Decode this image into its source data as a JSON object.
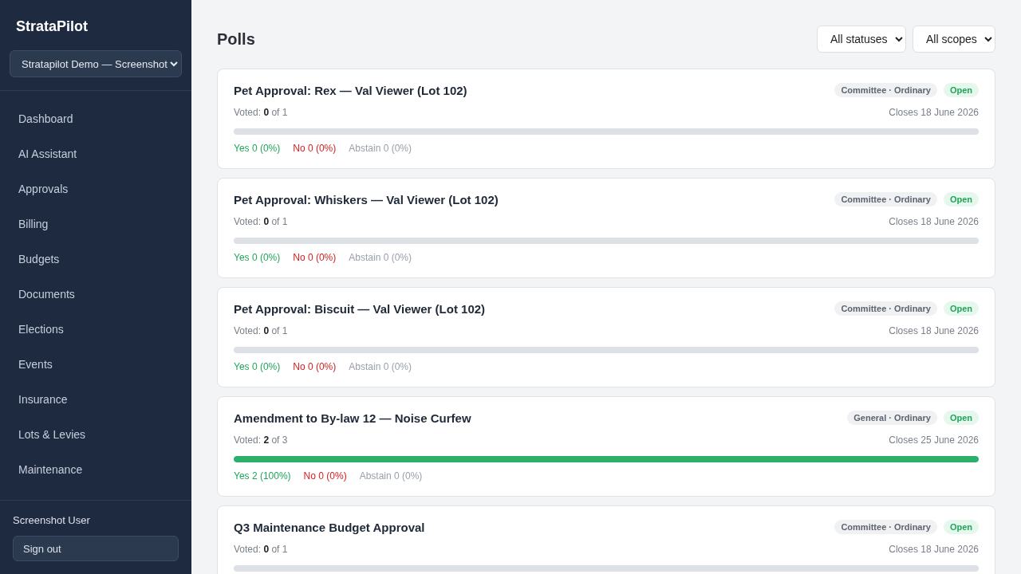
{
  "sidebar": {
    "brand": "StrataPilot",
    "scheme_select": {
      "value": "Stratapilot Demo — Screenshot"
    },
    "items": [
      {
        "label": "Dashboard"
      },
      {
        "label": "AI Assistant"
      },
      {
        "label": "Approvals"
      },
      {
        "label": "Billing"
      },
      {
        "label": "Budgets"
      },
      {
        "label": "Documents"
      },
      {
        "label": "Elections"
      },
      {
        "label": "Events"
      },
      {
        "label": "Insurance"
      },
      {
        "label": "Lots & Levies"
      },
      {
        "label": "Maintenance"
      }
    ],
    "user": "Screenshot User",
    "sign_out": "Sign out"
  },
  "page": {
    "title": "Polls",
    "filters": [
      {
        "value": "All statuses"
      },
      {
        "value": "All scopes"
      }
    ]
  },
  "polls": [
    {
      "title": "Pet Approval: Rex — Val Viewer (Lot 102)",
      "scope": "Committee · Ordinary",
      "status": "Open",
      "voted": "Voted: **0** of 1",
      "closes": "Closes 18 June 2026",
      "level": 0,
      "tallies": [
        {
          "kind": "yes",
          "text": "Yes 0 (0%)"
        },
        {
          "kind": "no",
          "text": "No 0 (0%)"
        },
        {
          "kind": "abstain",
          "text": "Abstain 0 (0%)"
        }
      ]
    },
    {
      "title": "Pet Approval: Whiskers — Val Viewer (Lot 102)",
      "scope": "Committee · Ordinary",
      "status": "Open",
      "voted": "Voted: **0** of 1",
      "closes": "Closes 18 June 2026",
      "level": 0,
      "tallies": [
        {
          "kind": "yes",
          "text": "Yes 0 (0%)"
        },
        {
          "kind": "no",
          "text": "No 0 (0%)"
        },
        {
          "kind": "abstain",
          "text": "Abstain 0 (0%)"
        }
      ]
    },
    {
      "title": "Pet Approval: Biscuit — Val Viewer (Lot 102)",
      "scope": "Committee · Ordinary",
      "status": "Open",
      "voted": "Voted: **0** of 1",
      "closes": "Closes 18 June 2026",
      "level": 0,
      "tallies": [
        {
          "kind": "yes",
          "text": "Yes 0 (0%)"
        },
        {
          "kind": "no",
          "text": "No 0 (0%)"
        },
        {
          "kind": "abstain",
          "text": "Abstain 0 (0%)"
        }
      ]
    },
    {
      "title": "Amendment to By-law 12 — Noise Curfew",
      "scope": "General · Ordinary",
      "status": "Open",
      "voted": "Voted: **2** of 3",
      "closes": "Closes 25 June 2026",
      "level": 1,
      "tallies": [
        {
          "kind": "yes",
          "text": "Yes 2 (100%)"
        },
        {
          "kind": "no",
          "text": "No 0 (0%)"
        },
        {
          "kind": "abstain",
          "text": "Abstain 0 (0%)"
        }
      ]
    },
    {
      "title": "Q3 Maintenance Budget Approval",
      "scope": "Committee · Ordinary",
      "status": "Open",
      "voted": "Voted: **0** of 1",
      "closes": "Closes 18 June 2026",
      "level": 0
    }
  ]
}
